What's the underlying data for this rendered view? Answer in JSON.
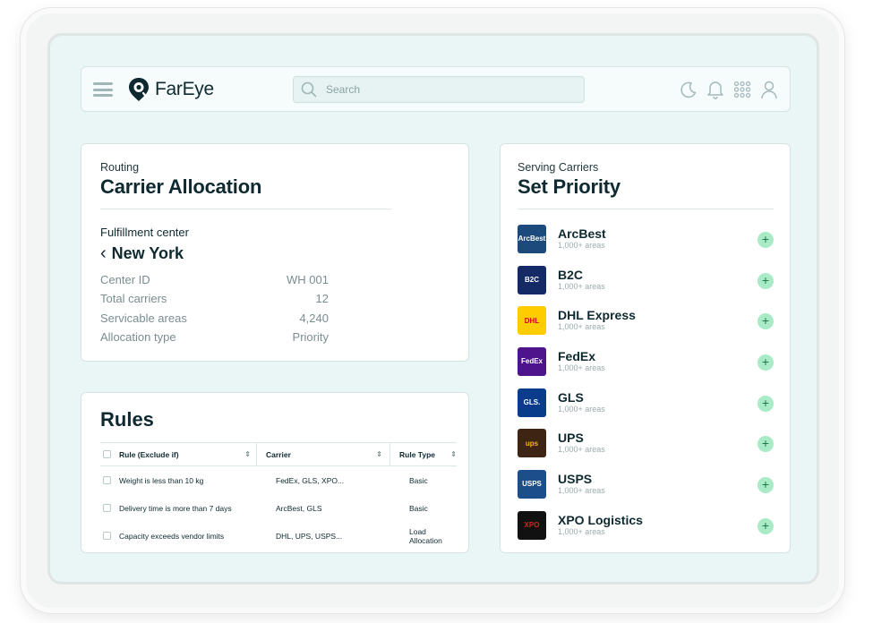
{
  "app": {
    "logo_text": "FarEye",
    "search_placeholder": "Search"
  },
  "header_icons": [
    "moon-icon",
    "bell-icon",
    "apps-grid-icon",
    "user-icon"
  ],
  "allocation": {
    "eyebrow": "Routing",
    "title": "Carrier Allocation",
    "fc_label": "Fulfillment center",
    "fc_city": "New York",
    "details": [
      {
        "label": "Center ID",
        "value": "WH 001"
      },
      {
        "label": "Total carriers",
        "value": "12"
      },
      {
        "label": "Servicable areas",
        "value": "4,240"
      },
      {
        "label": "Allocation type",
        "value": "Priority"
      }
    ]
  },
  "rules": {
    "title": "Rules",
    "headers": [
      "Rule (Exclude if)",
      "Carrier",
      "Rule Type"
    ],
    "rows": [
      {
        "rule": "Weight is less than 10 kg",
        "carrier": "FedEx, GLS, XPO...",
        "type": "Basic"
      },
      {
        "rule": "Delivery time is more than 7 days",
        "carrier": "ArcBest, GLS",
        "type": "Basic"
      },
      {
        "rule": "Capacity exceeds vendor limits",
        "carrier": "DHL, UPS, USPS...",
        "type": "Load Allocation"
      }
    ]
  },
  "carriers": {
    "eyebrow": "Serving Carriers",
    "title": "Set Priority",
    "items": [
      {
        "name": "ArcBest",
        "areas": "1,000+ areas",
        "logo_text": "ArcBest",
        "bg": "#1c4a7c",
        "fg": "#ffffff"
      },
      {
        "name": "B2C",
        "areas": "1,000+ areas",
        "logo_text": "B2C",
        "bg": "#142a66",
        "fg": "#ffffff"
      },
      {
        "name": "DHL Express",
        "areas": "1,000+ areas",
        "logo_text": "DHL",
        "bg": "#ffcc00",
        "fg": "#d40511"
      },
      {
        "name": "FedEx",
        "areas": "1,000+ areas",
        "logo_text": "FedEx",
        "bg": "#4d148c",
        "fg": "#ffffff"
      },
      {
        "name": "GLS",
        "areas": "1,000+ areas",
        "logo_text": "GLS.",
        "bg": "#0a3c8c",
        "fg": "#ffffff"
      },
      {
        "name": "UPS",
        "areas": "1,000+ areas",
        "logo_text": "ups",
        "bg": "#3d2413",
        "fg": "#ffb500"
      },
      {
        "name": "USPS",
        "areas": "1,000+ areas",
        "logo_text": "USPS",
        "bg": "#1b4e8a",
        "fg": "#ffffff"
      },
      {
        "name": "XPO Logistics",
        "areas": "1,000+ areas",
        "logo_text": "XPO",
        "bg": "#111111",
        "fg": "#e0201b"
      }
    ]
  }
}
